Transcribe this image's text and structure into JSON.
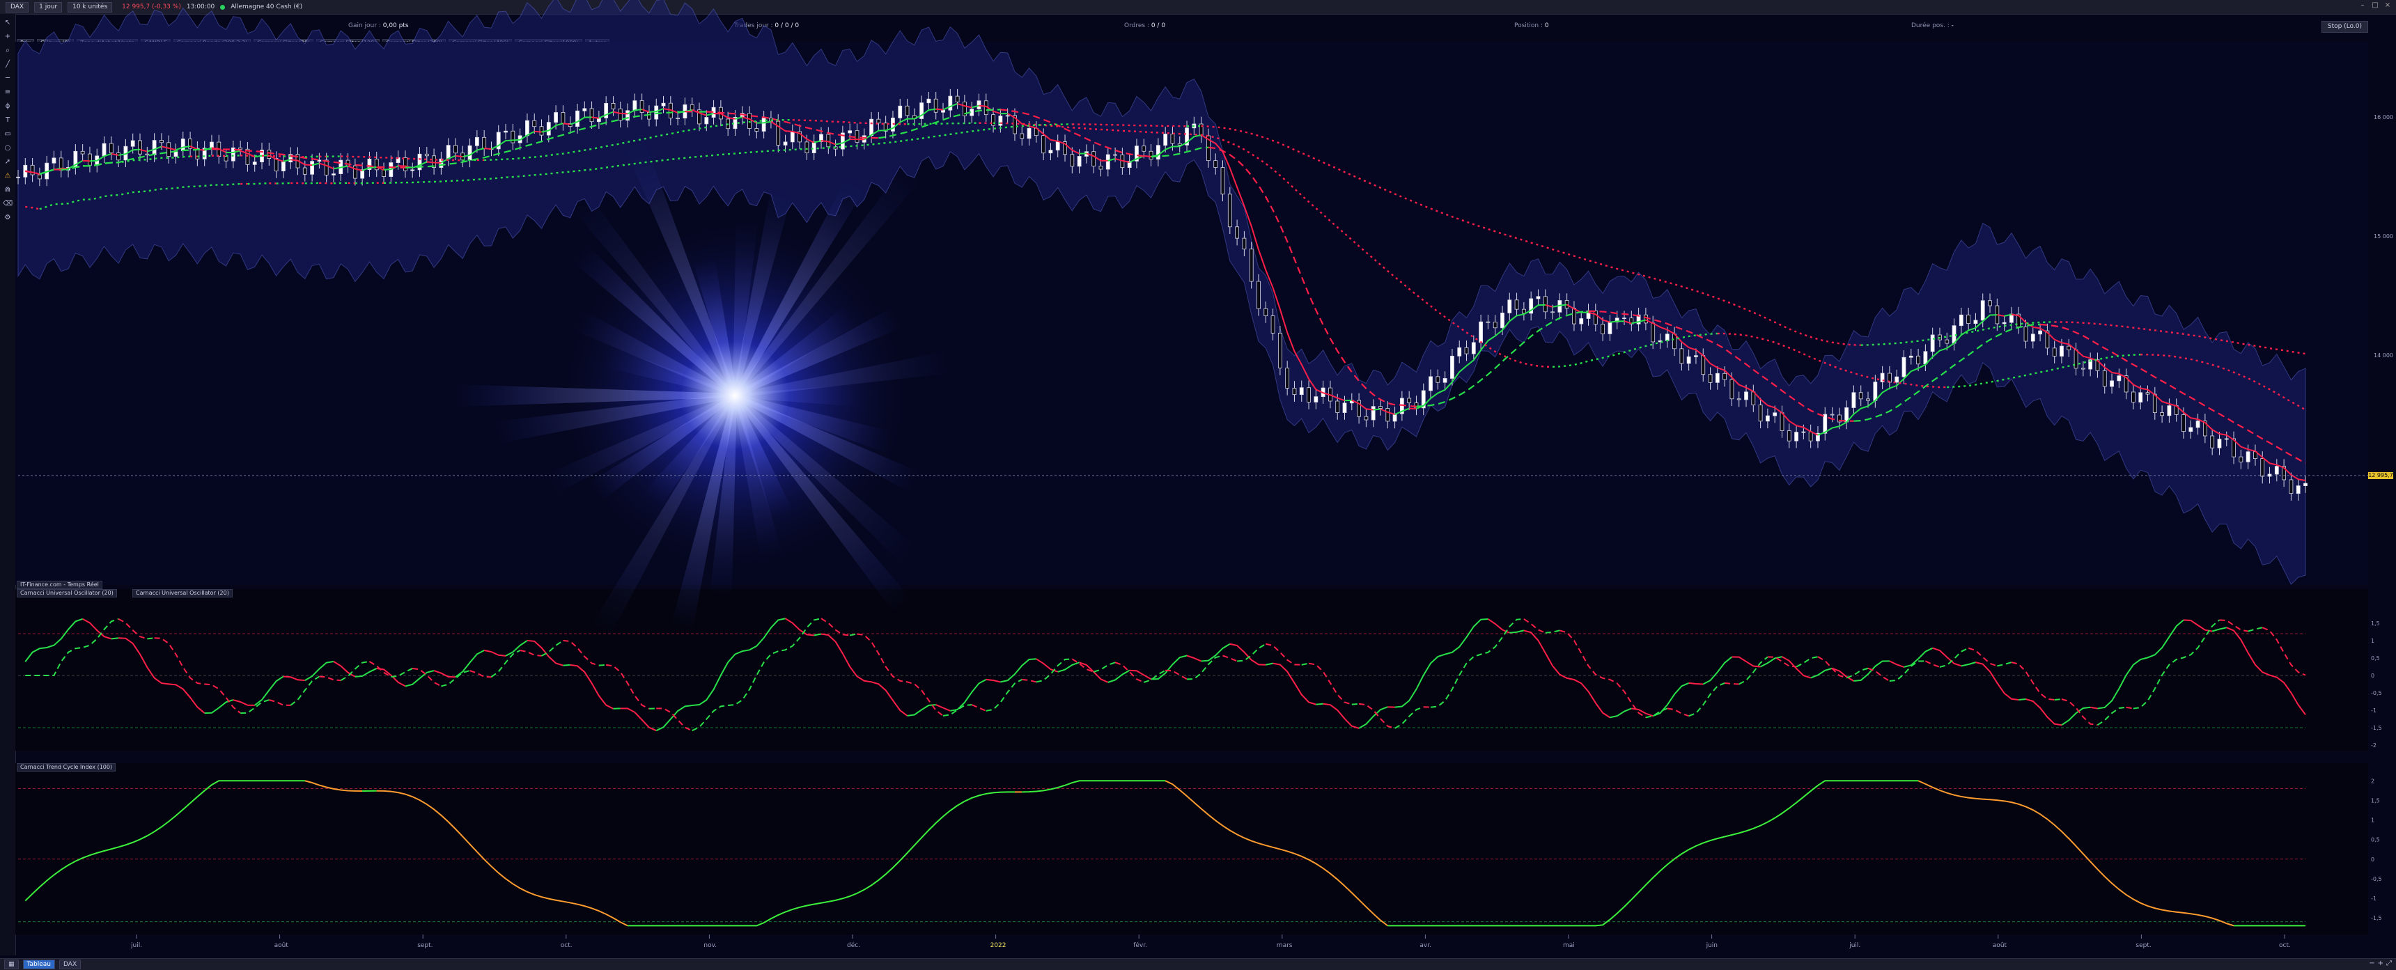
{
  "topbar": {
    "instrument": "DAX",
    "period": "1 jour",
    "units": "10 k unités",
    "price": "12 995,7 (-0,33 %)",
    "time": "13:00:00",
    "market": "Allemagne 40 Cash (€)"
  },
  "status": {
    "gain_label": "Gain jour :",
    "gain_value": "0,00 pts",
    "trades_label": "Trades jour :",
    "trades_value": "0 / 0 / 0",
    "orders_label": "Ordres :",
    "orders_value": "0 / 0",
    "position_label": "Position :",
    "position_value": "0",
    "duration_label": "Durée pos. :",
    "duration_value": "-",
    "stop_button": "Stop (Lo.0)"
  },
  "indicators": [
    "Prix",
    "Clôture (0)",
    "Zone d'Achat/Vente",
    "CANDLE",
    "Carnacci Bands (200,2.3)",
    "Carnacci Filter (20)",
    "Carnacci Filter (100)",
    "Carnacci Filter (200)",
    "Carnacci Filter (400)",
    "Carnacci Filter (1000)",
    "Autres"
  ],
  "panels": {
    "source_label": "IT-Finance.com - Temps Réel",
    "osc_label_1": "Carnacci Universal Oscillator (20)",
    "osc_label_2": "Carnacci Universal Oscillator (20)",
    "tci_label": "Carnacci Trend Cycle Index (100)"
  },
  "price_axis": {
    "labels": [
      "16 000",
      "15 000",
      "14 000",
      "13 000"
    ],
    "current": "12 995,7"
  },
  "osc_axis": [
    "1,5",
    "1",
    "0,5",
    "0",
    "-0,5",
    "-1",
    "-1,5",
    "-2"
  ],
  "tci_axis": [
    "2",
    "1,5",
    "1",
    "0,5",
    "0",
    "-0,5",
    "-1",
    "-1,5"
  ],
  "date_axis": [
    "juil.",
    "août",
    "sept.",
    "oct.",
    "nov.",
    "déc.",
    "2022",
    "févr.",
    "mars",
    "avr.",
    "mai",
    "juin",
    "juil.",
    "août",
    "sept.",
    "oct."
  ],
  "bottombar": {
    "tabs": [
      "Tableau",
      "DAX"
    ]
  },
  "colors": {
    "bullish": "#27e04a",
    "bearish": "#ff1f49",
    "trend_up": "#3cf03c",
    "trend_down": "#ff9b2f",
    "band_fill": "#1a1f6e"
  }
}
